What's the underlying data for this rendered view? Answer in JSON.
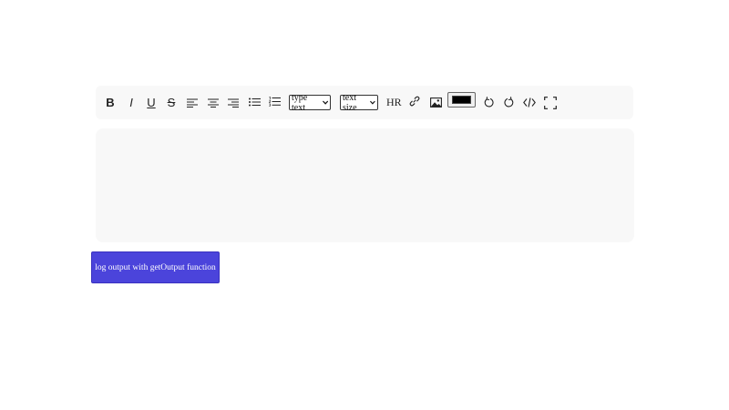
{
  "toolbar": {
    "bold_label": "B",
    "italic_label": "I",
    "underline_label": "U",
    "strike_label": "S",
    "type_select_value": "type text",
    "size_select_value": "text size",
    "hr_label": "HR",
    "color_value": "#000000",
    "icons": [
      "bold-icon",
      "italic-icon",
      "underline-icon",
      "strikethrough-icon",
      "align-left-icon",
      "align-center-icon",
      "align-right-icon",
      "unordered-list-icon",
      "ordered-list-icon",
      "link-icon",
      "image-icon",
      "undo-icon",
      "redo-icon",
      "code-icon",
      "fullscreen-icon"
    ]
  },
  "editor": {
    "content": ""
  },
  "actions": {
    "log_button_label": "log output with getOutput function",
    "log_button_color": "#4b44db"
  }
}
